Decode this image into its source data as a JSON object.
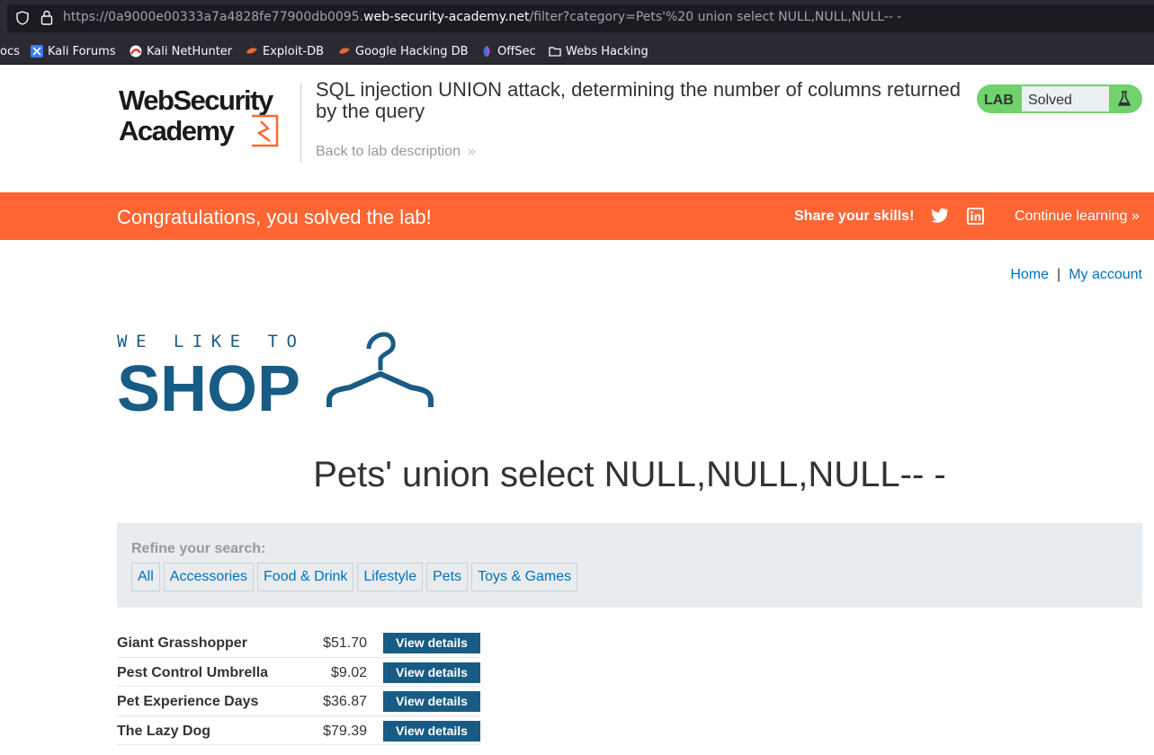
{
  "browser": {
    "url_prefix": "https://0a9000e00333a7a4828fe77900db0095.",
    "url_domain": "web-security-academy.net",
    "url_path": "/filter?category=Pets'%20 union select NULL,NULL,NULL-- -",
    "bookmarks": [
      {
        "label": "ocs"
      },
      {
        "label": "Kali Forums"
      },
      {
        "label": "Kali NetHunter"
      },
      {
        "label": "Exploit-DB"
      },
      {
        "label": "Google Hacking DB"
      },
      {
        "label": "OffSec"
      },
      {
        "label": "Webs Hacking"
      }
    ]
  },
  "lab": {
    "title": "SQL injection UNION attack, determining the number of columns returned by the query",
    "back_link": "Back to lab description",
    "badge_label": "LAB",
    "status": "Solved"
  },
  "banner": {
    "message": "Congratulations, you solved the lab!",
    "share": "Share your skills!",
    "continue": "Continue learning",
    "color": "#ff6633"
  },
  "nav": {
    "home": "Home",
    "separator": "|",
    "account": "My account"
  },
  "shop": {
    "heading": "Pets' union select NULL,NULL,NULL-- -",
    "refine_label": "Refine your search:",
    "categories": [
      "All",
      "Accessories",
      "Food & Drink",
      "Lifestyle",
      "Pets",
      "Toys & Games"
    ],
    "products": [
      {
        "name": "Giant Grasshopper",
        "price": "$51.70",
        "button": "View details"
      },
      {
        "name": "Pest Control Umbrella",
        "price": "$9.02",
        "button": "View details"
      },
      {
        "name": "Pet Experience Days",
        "price": "$36.87",
        "button": "View details"
      },
      {
        "name": "The Lazy Dog",
        "price": "$79.39",
        "button": "View details"
      }
    ]
  }
}
